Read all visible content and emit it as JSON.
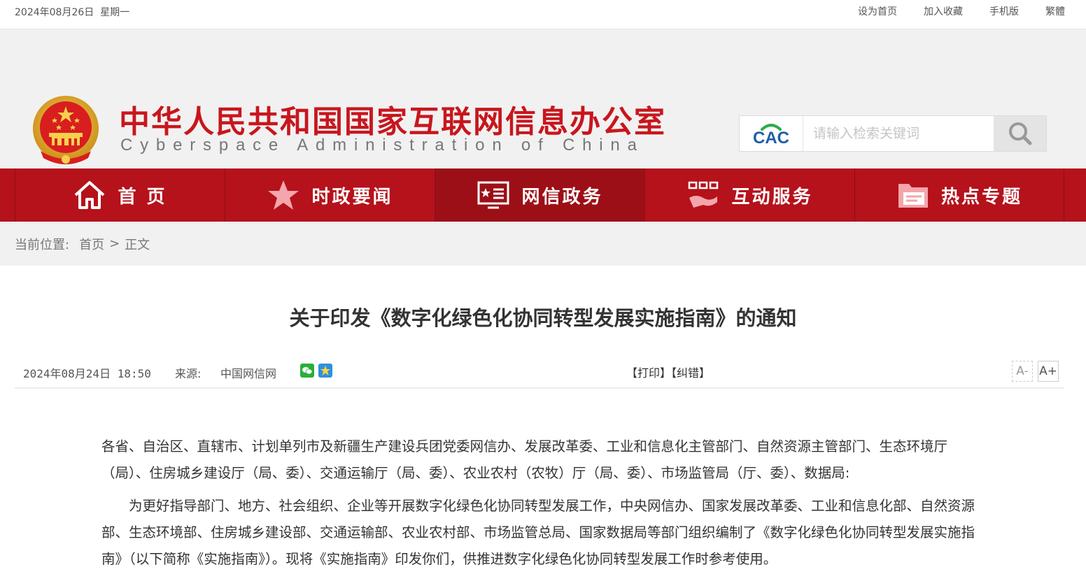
{
  "topbar": {
    "date": "2024年08月26日",
    "weekday": "星期一",
    "links": [
      "设为首页",
      "加入收藏",
      "手机版",
      "繁體"
    ]
  },
  "header": {
    "title_cn": "中华人民共和国国家互联网信息办公室",
    "title_en": "Cyberspace Administration of China",
    "search_logo": "CAC",
    "search_placeholder": "请输入检索关键词",
    "search_icon": "search-icon"
  },
  "nav": {
    "items": [
      {
        "label": "首 页",
        "icon": "home-icon"
      },
      {
        "label": "时政要闻",
        "icon": "star-icon"
      },
      {
        "label": "网信政务",
        "icon": "monitor-icon"
      },
      {
        "label": "互动服务",
        "icon": "handshake-icon"
      },
      {
        "label": "热点专题",
        "icon": "folder-icon"
      }
    ],
    "active": 2,
    "colors": {
      "bar": "#b5121b",
      "active": "#9c0f17"
    }
  },
  "breadcrumb": {
    "label": "当前位置:",
    "home": "首页",
    "separator": ">",
    "current": "正文"
  },
  "article": {
    "title": "关于印发《数字化绿色化协同转型发展实施指南》的通知",
    "date": "2024年08月24日",
    "time": "18:50",
    "source_label": "来源:",
    "source": "中国网信网",
    "print": "【打印】",
    "correct": "【纠错】",
    "font_decrease": "A-",
    "font_increase": "A+",
    "paragraphs": [
      "各省、自治区、直辖市、计划单列市及新疆生产建设兵团党委网信办、发展改革委、工业和信息化主管部门、自然资源主管部门、生态环境厅（局）、住房城乡建设厅（局、委）、交通运输厅（局、委）、农业农村（农牧）厅（局、委）、市场监管局（厅、委）、数据局:",
      "为更好指导部门、地方、社会组织、企业等开展数字化绿色化协同转型发展工作，中央网信办、国家发展改革委、工业和信息化部、自然资源部、生态环境部、住房城乡建设部、交通运输部、农业农村部、市场监管总局、国家数据局等部门组织编制了《数字化绿色化协同转型发展实施指南》（以下简称《实施指南》）。现将《实施指南》印发你们，供推进数字化绿色化协同转型发展工作时参考使用。"
    ]
  },
  "brand_color": "#c8161d"
}
